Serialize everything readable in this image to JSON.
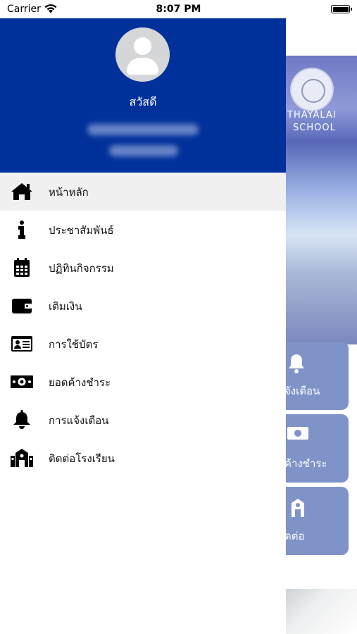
{
  "status_bar": {
    "carrier": "Carrier",
    "time": "8:07 PM"
  },
  "drawer": {
    "header_color": "#00309a",
    "greeting": "สวัสดี",
    "menu": [
      {
        "label": "หน้าหลัก",
        "icon": "home-icon",
        "active": true
      },
      {
        "label": "ประชาสัมพันธ์",
        "icon": "info-icon"
      },
      {
        "label": "ปฏิทินกิจกรรม",
        "icon": "calendar-icon"
      },
      {
        "label": "เติมเงิน",
        "icon": "wallet-icon"
      },
      {
        "label": "การใช้บัตร",
        "icon": "id-card-icon"
      },
      {
        "label": "ยอดค้างชำระ",
        "icon": "money-bill-icon"
      },
      {
        "label": "การแจ้งเตือน",
        "icon": "bell-icon"
      },
      {
        "label": "ติดต่อโรงเรียน",
        "icon": "school-icon"
      }
    ]
  },
  "background_app": {
    "school_text_1": "THAYALAI",
    "school_text_2": "SCHOOL",
    "cards": [
      {
        "label": "จังเตือน",
        "icon": "bell-icon"
      },
      {
        "label": "ค้างชำระ",
        "icon": "money-bill-icon"
      },
      {
        "label": "ดต่อ",
        "icon": "school-icon"
      }
    ]
  }
}
